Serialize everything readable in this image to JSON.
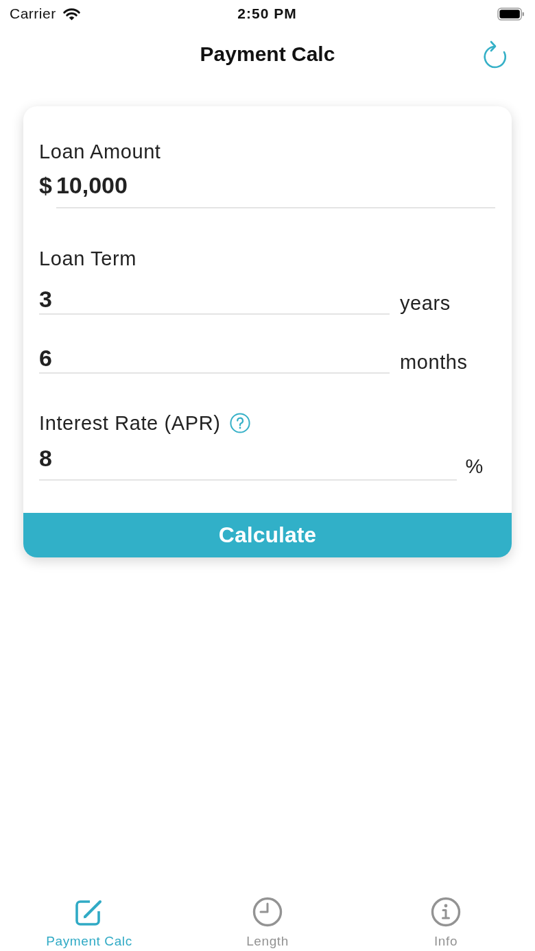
{
  "status_bar": {
    "carrier": "Carrier",
    "time": "2:50 PM"
  },
  "nav_bar": {
    "title": "Payment Calc"
  },
  "form": {
    "sections": [
      {
        "kind": "amount",
        "label": "Loan Amount",
        "help": false,
        "rows": [
          {
            "prefix": "$",
            "value": "10,000"
          }
        ]
      },
      {
        "kind": "term",
        "label": "Loan Term",
        "help": false,
        "rows": [
          {
            "value": "3",
            "unit": "years"
          },
          {
            "value": "6",
            "unit": "months"
          }
        ]
      },
      {
        "kind": "rate",
        "label": "Interest Rate (APR)",
        "help": true,
        "rows": [
          {
            "value": "8",
            "unit": "%"
          }
        ]
      }
    ],
    "button": "Calculate"
  },
  "tab_bar": [
    {
      "kind": "compose",
      "label": "Payment Calc",
      "selected": true
    },
    {
      "kind": "clock",
      "label": "Length",
      "selected": false
    },
    {
      "kind": "info",
      "label": "Info",
      "selected": false
    }
  ]
}
